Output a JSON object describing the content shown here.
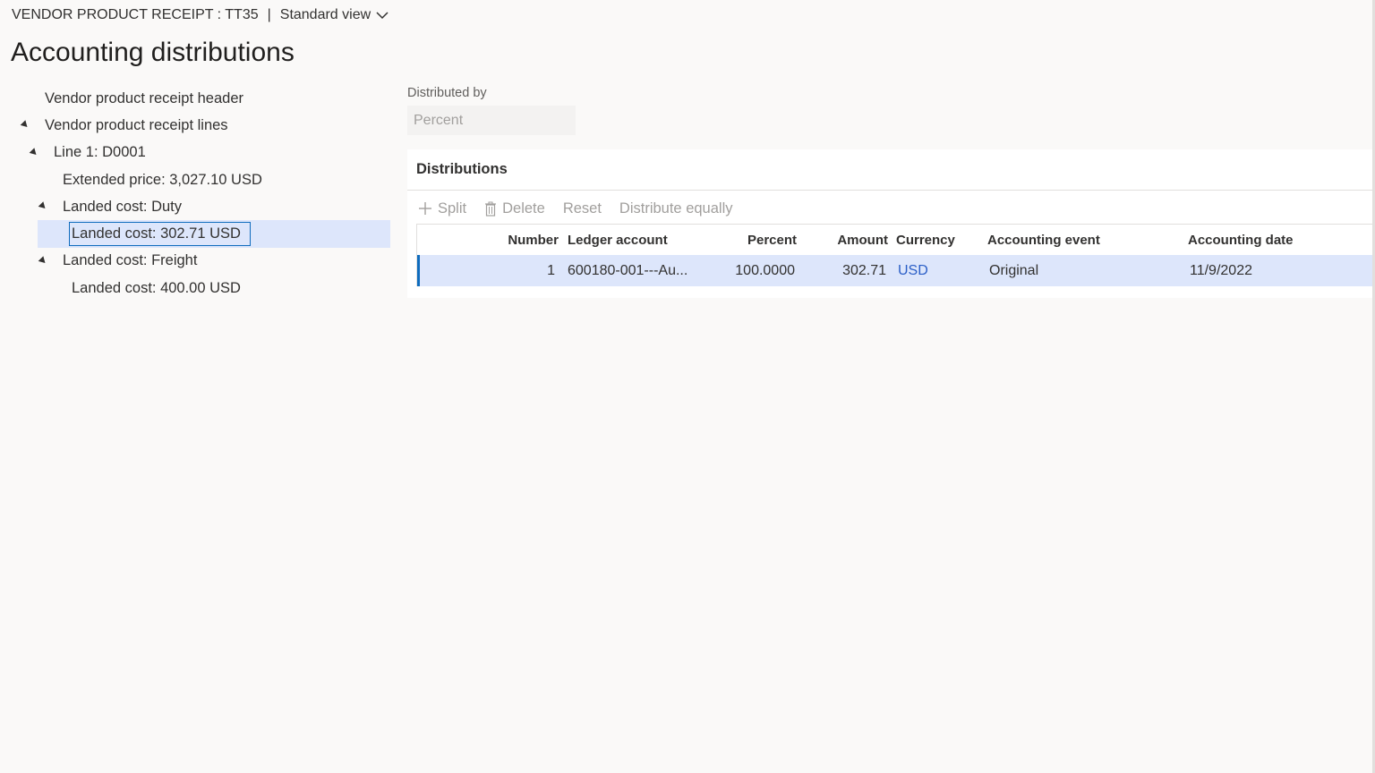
{
  "header": {
    "entity": "VENDOR PRODUCT RECEIPT : TT35",
    "separator": "|",
    "view_label": "Standard view"
  },
  "page": {
    "title": "Accounting distributions"
  },
  "tree": {
    "nodes": [
      {
        "label": "Vendor product receipt header"
      },
      {
        "label": "Vendor product receipt lines"
      },
      {
        "label": "Line 1: D0001"
      },
      {
        "label": "Extended price: 3,027.10 USD"
      },
      {
        "label": "Landed cost: Duty"
      },
      {
        "label": "Landed cost: 302.71 USD"
      },
      {
        "label": "Landed cost: Freight"
      },
      {
        "label": "Landed cost: 400.00 USD"
      }
    ]
  },
  "distributed_by": {
    "label": "Distributed by",
    "value": "Percent"
  },
  "distributions": {
    "title": "Distributions",
    "toolbar": {
      "split": "Split",
      "delete": "Delete",
      "reset": "Reset",
      "distribute_equally": "Distribute equally"
    },
    "columns": {
      "number": "Number",
      "ledger_account": "Ledger account",
      "percent": "Percent",
      "amount": "Amount",
      "currency": "Currency",
      "accounting_event": "Accounting event",
      "accounting_date": "Accounting date"
    },
    "rows": [
      {
        "number": "1",
        "ledger_account": "600180-001---Au...",
        "percent": "100.0000",
        "amount": "302.71",
        "currency": "USD",
        "accounting_event": "Original",
        "accounting_date": "11/9/2022"
      }
    ]
  },
  "colors": {
    "accent": "#0f6cbd",
    "selection": "#dde6fb",
    "link": "#2b5fc7"
  }
}
